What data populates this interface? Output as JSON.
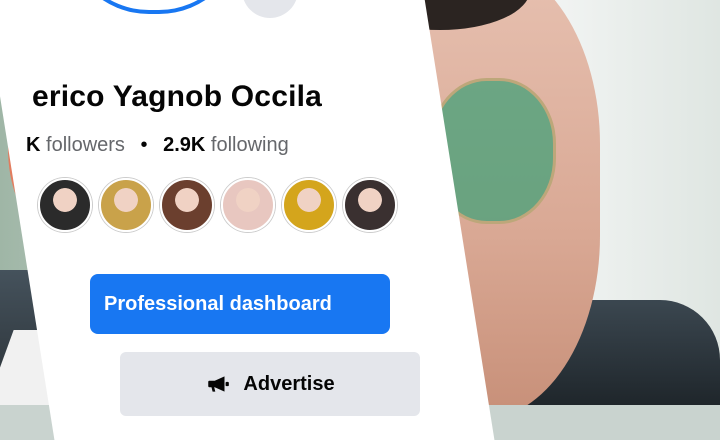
{
  "profile": {
    "name": "erico Yagnob Occila",
    "followers_value": "K",
    "followers_label": "followers",
    "separator": "•",
    "following_value": "2.9K",
    "following_label": "following"
  },
  "icons": {
    "camera": "camera-icon",
    "megaphone": "megaphone-icon"
  },
  "friends": [
    {
      "color": "#2b2b2b"
    },
    {
      "color": "#c9a24a"
    },
    {
      "color": "#6b3f2e"
    },
    {
      "color": "#e8c7c0"
    },
    {
      "color": "#d4a51c"
    },
    {
      "color": "#3a3030"
    }
  ],
  "actions": {
    "professional_dashboard": "Professional dashboard",
    "advertise": "Advertise"
  },
  "colors": {
    "accent": "#1877f2",
    "secondary_button": "#e4e6eb",
    "muted_text": "#65676b"
  }
}
